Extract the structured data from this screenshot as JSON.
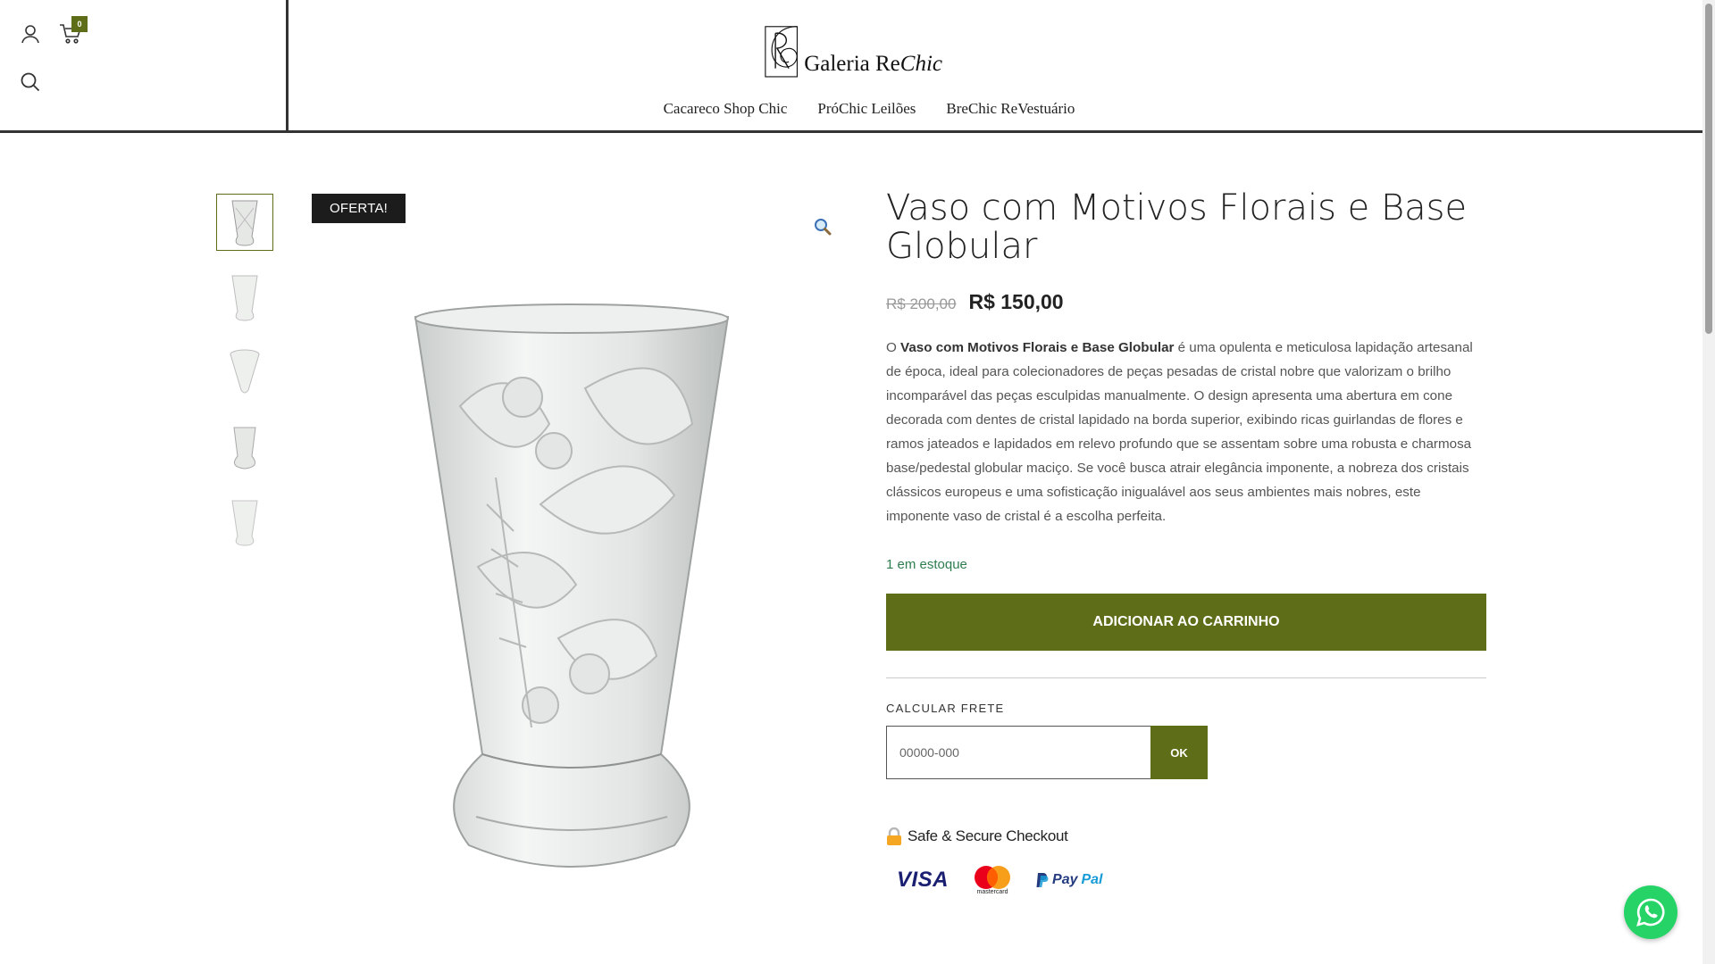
{
  "header": {
    "logo_text": "Galeria Re",
    "logo_italic": "Chic",
    "cart_count": "0",
    "icons": {
      "user": "user-icon",
      "cart": "cart-icon",
      "search": "search-icon"
    }
  },
  "nav": {
    "items": [
      {
        "label": "Cacareco Shop Chic"
      },
      {
        "label": "PróChic Leilões"
      },
      {
        "label": "BreChic ReVestuário"
      }
    ]
  },
  "gallery": {
    "badge": "OFERTA!",
    "zoom_icon": "magnifier-icon",
    "thumbnails_count": 5,
    "active_thumbnail": 0
  },
  "product": {
    "title": "Vaso com Motivos Florais e Base Globular",
    "price_old": "R$ 200,00",
    "price_new": "R$ 150,00",
    "desc_prefix": "O ",
    "desc_bold": "Vaso com Motivos Florais e Base Globular",
    "desc_rest": " é uma opulenta e meticulosa lapidação artesanal de época, ideal para colecionadores de peças pesadas de cristal nobre que valorizam o brilho incomparável das peças esculpidas manualmente. O design apresenta uma abertura em cone decorada com dentes de cristal lapidado na borda superior, exibindo ricas guirlandas de flores e ramos jateados e lapidados em relevo profundo que se assentam sobre uma robusta e charmosa base/pedestal globular maciço. Se você busca atrair elegância imponente, a nobreza dos cristais clássicos europeus e uma sofisticação inigualável aos seus ambientes mais nobres, este imponente vaso de cristal é a escolha perfeita.",
    "stock": "1 em estoque",
    "add_to_cart": "ADICIONAR AO CARRINHO"
  },
  "shipping": {
    "label": "CALCULAR FRETE",
    "placeholder": "00000-000",
    "button": "OK"
  },
  "checkout": {
    "secure_text": "Safe & Secure Checkout",
    "cards": {
      "visa": "VISA",
      "mastercard": "mastercard",
      "paypal_a": "Pay",
      "paypal_b": "Pal"
    }
  },
  "colors": {
    "accent": "#5e6e18",
    "badge": "#1c1c1c",
    "stock": "#2e7d4f",
    "whatsapp": "#25d366"
  }
}
